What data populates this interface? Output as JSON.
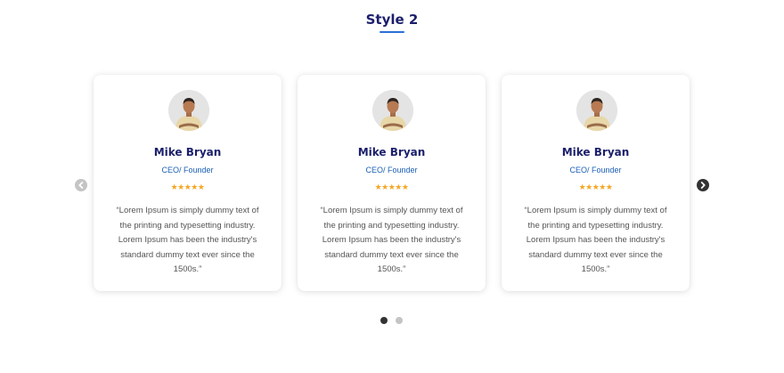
{
  "section": {
    "title": "Style 2",
    "accent_color": "#2a6fd6",
    "title_color": "#1b1f6b"
  },
  "carousel": {
    "prev_icon": "chevron-left-icon",
    "next_icon": "chevron-right-icon",
    "pagination": {
      "total_pages": 2,
      "active_page": 1
    },
    "cards": [
      {
        "name": "Mike Bryan",
        "role": "CEO/ Founder",
        "rating_stars": "★★★★★",
        "rating": 5,
        "quote": "“Lorem Ipsum is simply dummy text of the printing and typesetting industry. Lorem Ipsum has been the industry's standard dummy text ever since the 1500s.”",
        "avatar_icon": "person-avatar"
      },
      {
        "name": "Mike Bryan",
        "role": "CEO/ Founder",
        "rating_stars": "★★★★★",
        "rating": 5,
        "quote": "“Lorem Ipsum is simply dummy text of the printing and typesetting industry. Lorem Ipsum has been the industry's standard dummy text ever since the 1500s.”",
        "avatar_icon": "person-avatar"
      },
      {
        "name": "Mike Bryan",
        "role": "CEO/ Founder",
        "rating_stars": "★★★★★",
        "rating": 5,
        "quote": "“Lorem Ipsum is simply dummy text of the printing and typesetting industry. Lorem Ipsum has been the industry's standard dummy text ever since the 1500s.”",
        "avatar_icon": "person-avatar"
      }
    ],
    "colors": {
      "name": "#1b1f6b",
      "role": "#1a5fb4",
      "stars": "#f5a623",
      "body_text": "#555555"
    }
  }
}
